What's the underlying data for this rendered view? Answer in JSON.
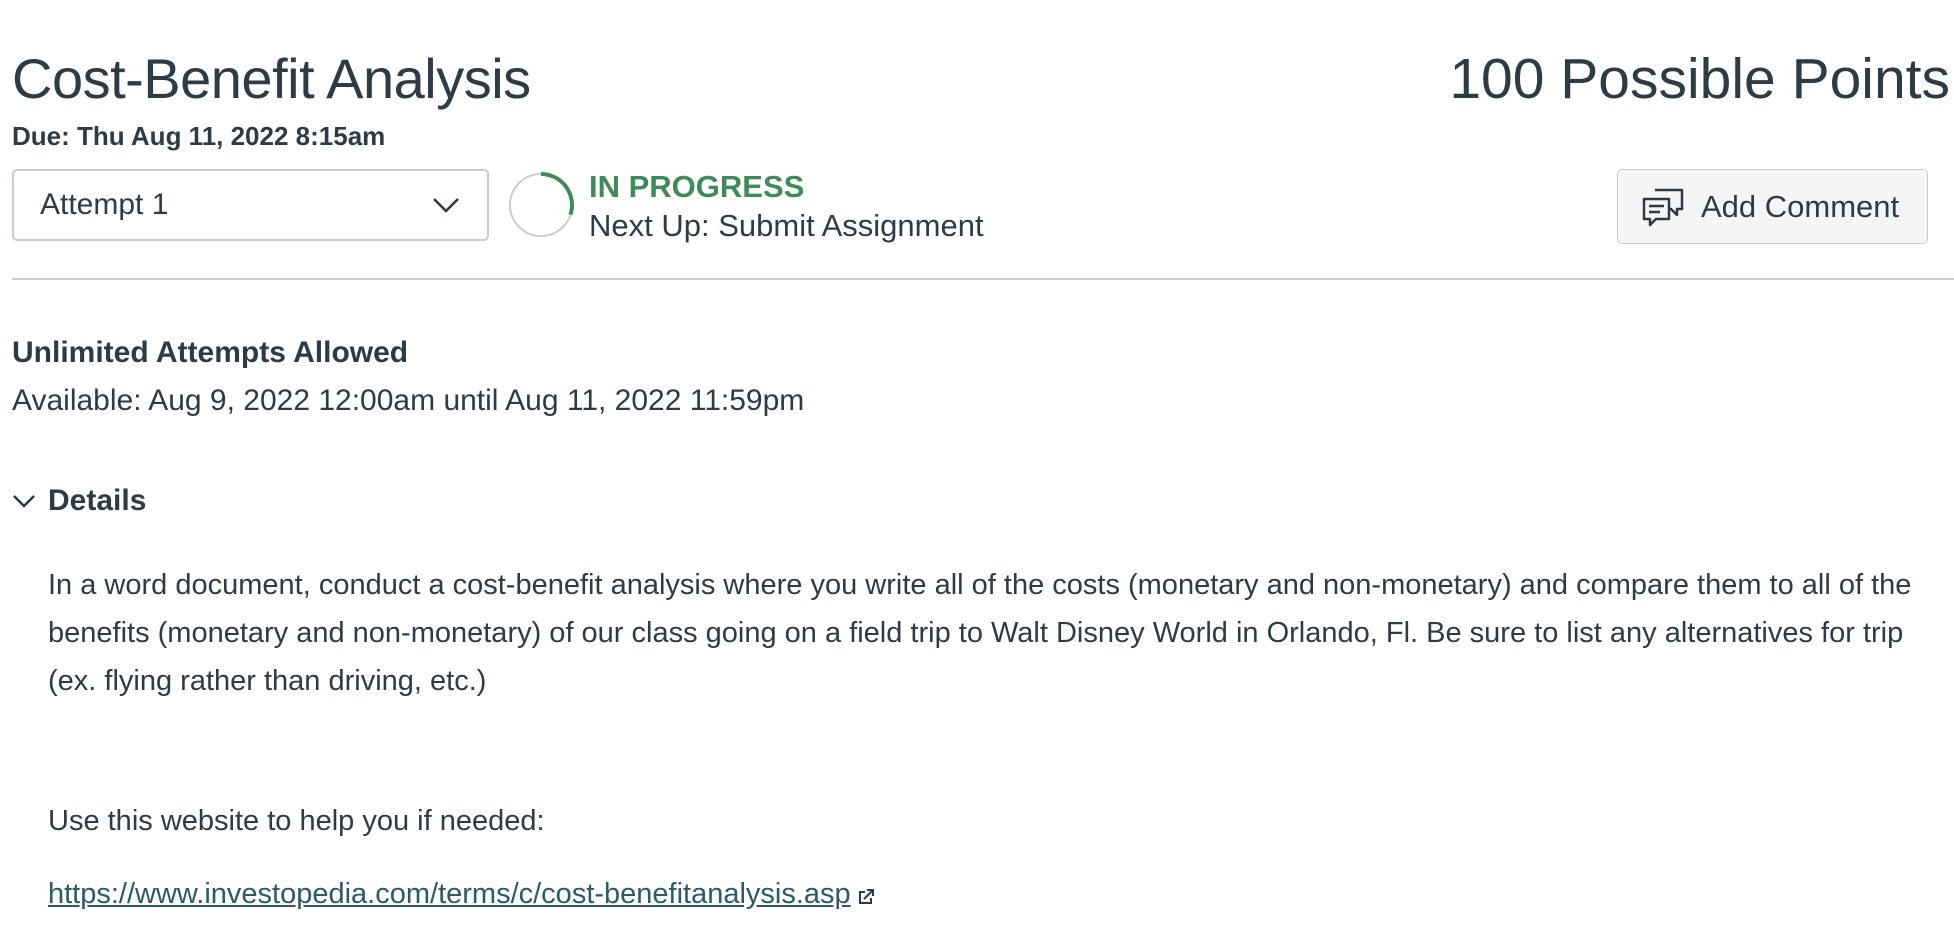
{
  "assignment": {
    "title": "Cost-Benefit Analysis",
    "points_label": "100 Possible Points",
    "due_label": "Due: Thu Aug 11, 2022 8:15am"
  },
  "attempt": {
    "selected": "Attempt 1"
  },
  "progress": {
    "status": "IN PROGRESS",
    "next_up": "Next Up: Submit Assignment",
    "fraction": 0.3,
    "color": "#3f8b57"
  },
  "actions": {
    "add_comment_label": "Add Comment"
  },
  "info": {
    "attempts_allowed": "Unlimited Attempts Allowed",
    "available": "Available: Aug 9, 2022 12:00am until Aug 11, 2022 11:59pm"
  },
  "details": {
    "toggle_label": "Details",
    "description": "In a word document, conduct a cost-benefit analysis where you write all of the costs (monetary and non-monetary) and compare them to all of the benefits (monetary and non-monetary) of our class going on a field trip to Walt Disney World in Orlando, Fl. Be sure to list any alternatives for trip (ex. flying rather than driving, etc.)",
    "help_text": "Use this website to help you if needed:",
    "link_text": "https://www.investopedia.com/terms/c/cost-benefitanalysis.asp"
  },
  "icons": {
    "select": "chevron-down-icon",
    "comment": "comment-icon",
    "details": "chevron-down-icon",
    "external": "external-link-icon"
  }
}
